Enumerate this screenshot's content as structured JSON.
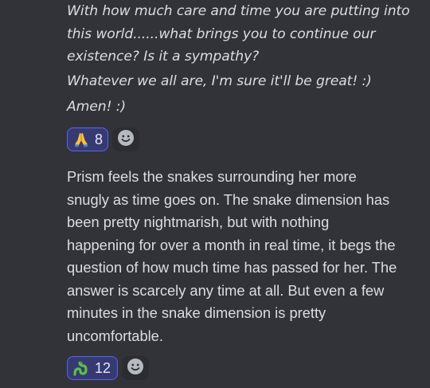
{
  "message1": {
    "lines": [
      "With how much care and time you are putting into",
      "this world......what brings you to continue our",
      "existence? Is it a sympathy?",
      "Whatever we all are, I'm sure it'll be great! :)",
      "Amen! :)"
    ],
    "reaction": {
      "emoji": "folded-hands-emoji",
      "count": "8"
    }
  },
  "message2": {
    "lines": [
      "Prism feels the snakes surrounding her more",
      "snugly as time goes on. The snake dimension has",
      "been pretty nightmarish, but with nothing",
      "happening for over a month in real time, it begs the",
      "question of how much time has passed for her. The",
      "answer is scarcely any time at all. But even a few",
      "minutes in the snake dimension is pretty",
      "uncomfortable."
    ],
    "reaction": {
      "emoji": "snake-emoji",
      "count": "12"
    }
  },
  "colors": {
    "background": "#313338",
    "text": "#dbdee1",
    "reaction_border": "#5865f2",
    "reaction_bg": "#373a70"
  },
  "icons": {
    "add_reaction": "smiley-add-reaction-icon"
  }
}
